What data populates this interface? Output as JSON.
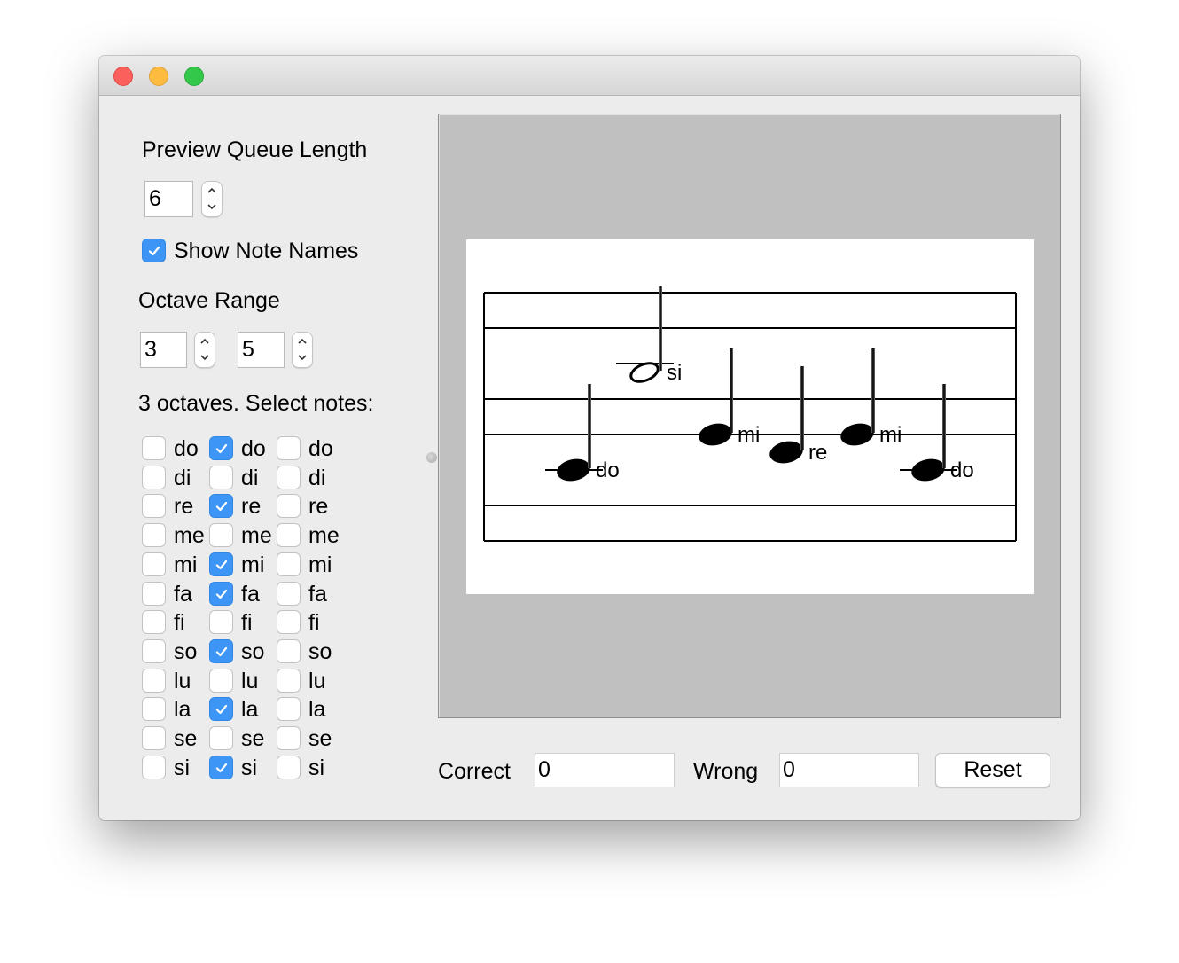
{
  "window": {
    "controls": [
      "close",
      "minimize",
      "zoom"
    ]
  },
  "settings": {
    "preview_queue_label": "Preview Queue Length",
    "preview_queue_value": "6",
    "show_note_names_label": "Show Note Names",
    "show_note_names_checked": true,
    "octave_range_label": "Octave Range",
    "octave_low": "3",
    "octave_high": "5",
    "octaves_summary": "3 octaves. Select notes:"
  },
  "note_grid": {
    "notes": [
      "do",
      "di",
      "re",
      "me",
      "mi",
      "fa",
      "fi",
      "so",
      "lu",
      "la",
      "se",
      "si"
    ],
    "columns": [
      {
        "octave": 1,
        "checked": [
          false,
          false,
          false,
          false,
          false,
          false,
          false,
          false,
          false,
          false,
          false,
          false
        ]
      },
      {
        "octave": 2,
        "checked": [
          true,
          false,
          true,
          false,
          true,
          true,
          false,
          true,
          false,
          true,
          false,
          true
        ]
      },
      {
        "octave": 3,
        "checked": [
          false,
          false,
          false,
          false,
          false,
          false,
          false,
          false,
          false,
          false,
          false,
          false
        ]
      }
    ]
  },
  "staff": {
    "colors": {
      "panel": "#c0c0c0",
      "paper": "#ffffff",
      "ink": "#000000"
    },
    "notes": [
      {
        "name": "do",
        "head": "filled",
        "ledger": true
      },
      {
        "name": "si",
        "head": "open",
        "ledger": true
      },
      {
        "name": "mi",
        "head": "filled",
        "ledger": false
      },
      {
        "name": "re",
        "head": "filled",
        "ledger": false
      },
      {
        "name": "mi",
        "head": "filled",
        "ledger": false
      },
      {
        "name": "do",
        "head": "filled",
        "ledger": true
      }
    ]
  },
  "score": {
    "correct_label": "Correct",
    "correct_value": "0",
    "wrong_label": "Wrong",
    "wrong_value": "0",
    "reset_label": "Reset"
  },
  "colors": {
    "checkbox_accent": "#3d96f5",
    "window_bg": "#ececec"
  }
}
